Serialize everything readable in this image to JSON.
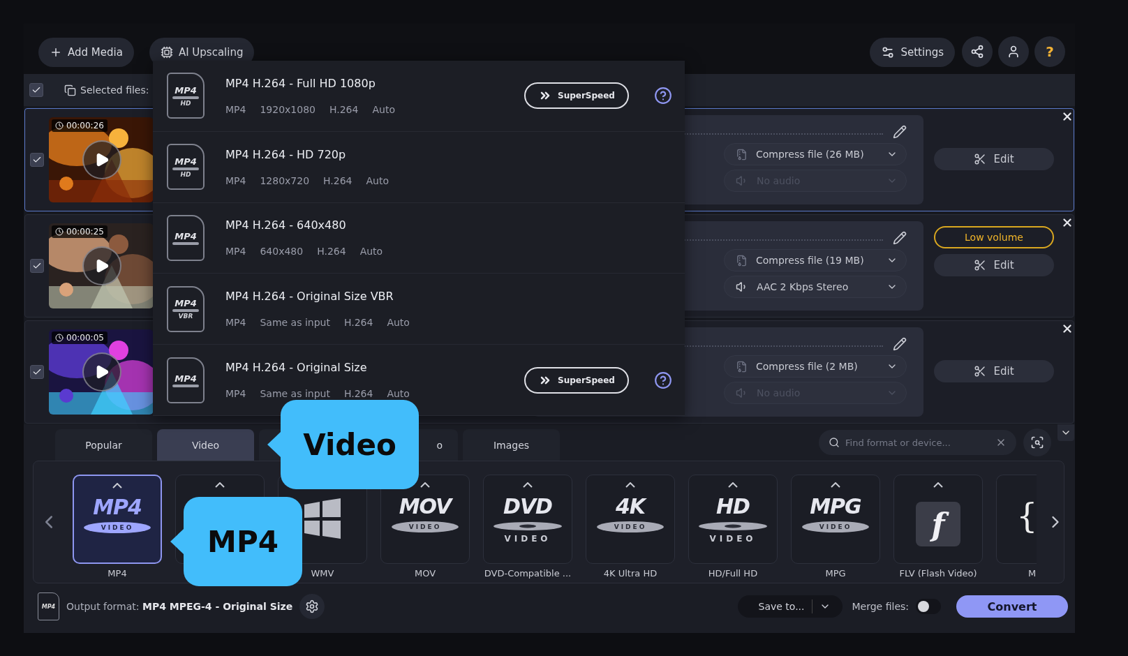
{
  "toolbar": {
    "add_media": "Add Media",
    "ai_upscaling": "AI Upscaling",
    "settings": "Settings",
    "help": "?"
  },
  "selection": {
    "checked": true,
    "label": "Selected files:"
  },
  "files": [
    {
      "duration": "00:00:26",
      "checked": true,
      "selected": true,
      "compress": "Compress file (26 MB)",
      "audio": {
        "label": "No audio",
        "disabled": true
      },
      "edit": "Edit"
    },
    {
      "duration": "00:00:25",
      "checked": true,
      "selected": false,
      "compress": "Compress file (19 MB)",
      "audio": {
        "label": "AAC 2 Kbps Stereo",
        "disabled": false
      },
      "warning": "Low volume",
      "edit": "Edit"
    },
    {
      "duration": "00:00:05",
      "checked": true,
      "selected": false,
      "compress": "Compress file (2 MB)",
      "audio": {
        "label": "No audio",
        "disabled": true
      },
      "edit": "Edit"
    }
  ],
  "format_menu": [
    {
      "icon_text": "MP4",
      "icon_badge": "HD",
      "title": "MP4 H.264 - Full HD 1080p",
      "specs": [
        "MP4",
        "1920x1080",
        "H.264",
        "Auto"
      ],
      "superspeed": "SuperSpeed"
    },
    {
      "icon_text": "MP4",
      "icon_badge": "HD",
      "title": "MP4 H.264 - HD 720p",
      "specs": [
        "MP4",
        "1280x720",
        "H.264",
        "Auto"
      ]
    },
    {
      "icon_text": "MP4",
      "title": "MP4 H.264 - 640x480",
      "specs": [
        "MP4",
        "640x480",
        "H.264",
        "Auto"
      ]
    },
    {
      "icon_text": "MP4",
      "icon_badge": "VBR",
      "title": "MP4 H.264 - Original Size VBR",
      "specs": [
        "MP4",
        "Same as input",
        "H.264",
        "Auto"
      ]
    },
    {
      "icon_text": "MP4",
      "title": "MP4 H.264 - Original Size",
      "specs": [
        "MP4",
        "Same as input",
        "H.264",
        "Auto"
      ],
      "superspeed": "SuperSpeed"
    }
  ],
  "category_tabs": [
    {
      "label": "Popular",
      "selected": false
    },
    {
      "label": "Video",
      "selected": true
    },
    {
      "selected": false
    },
    {
      "label": "o",
      "selected": false
    },
    {
      "label": "Images",
      "selected": false
    }
  ],
  "search": {
    "placeholder": "Find format or device..."
  },
  "formats": [
    {
      "kind": "logo",
      "logo": "MP4",
      "sub": "VIDEO",
      "label": "MP4",
      "selected": true
    },
    {
      "kind": "blank",
      "selected": false
    },
    {
      "kind": "windows",
      "label": "WMV",
      "selected": false
    },
    {
      "kind": "logo",
      "logo": "MOV",
      "sub": "VIDEO",
      "label": "MOV",
      "selected": false
    },
    {
      "kind": "disc",
      "logo": "DVD",
      "sub": "VIDEO",
      "label": "DVD-Compatible ...",
      "selected": false
    },
    {
      "kind": "logo",
      "logo": "4K",
      "sub": "VIDEO",
      "label": "4K Ultra HD",
      "selected": false
    },
    {
      "kind": "disc",
      "logo": "HD",
      "sub": "VIDEO",
      "label": "HD/Full HD",
      "selected": false
    },
    {
      "kind": "logo",
      "logo": "MPG",
      "sub": "VIDEO",
      "label": "MPG",
      "selected": false
    },
    {
      "kind": "flash",
      "logo": "f",
      "label": "FLV (Flash Video)",
      "selected": false
    },
    {
      "kind": "brace",
      "logo": "{",
      "label": "M",
      "selected": false
    }
  ],
  "output": {
    "icon_text": "MP4",
    "label": "Output format:",
    "value": "MP4 MPEG-4 - Original Size"
  },
  "save_to": "Save to...",
  "merge": {
    "label": "Merge files:",
    "on": false
  },
  "convert": "Convert",
  "callouts": [
    {
      "text": "Video"
    },
    {
      "text": "MP4"
    }
  ]
}
